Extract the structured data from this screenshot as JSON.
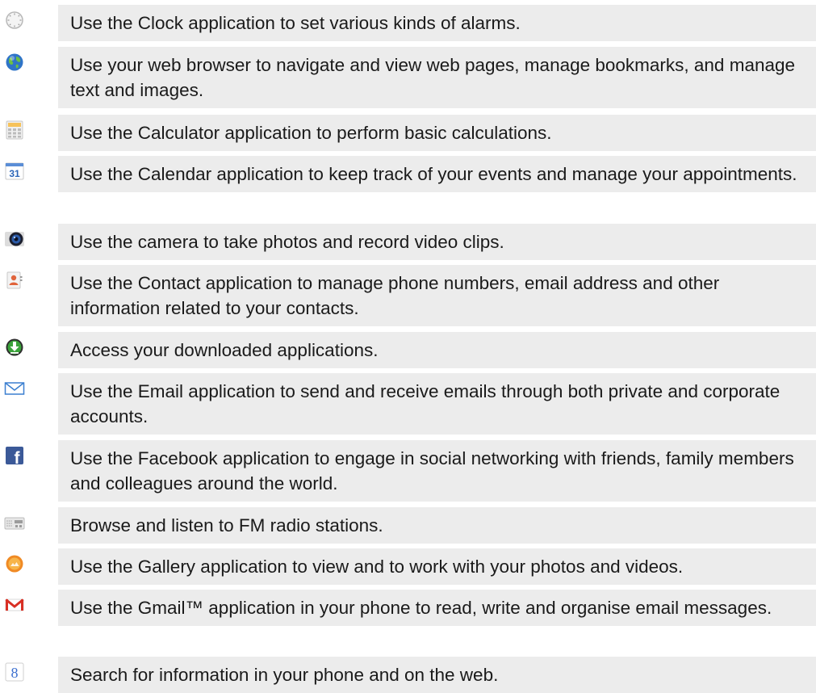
{
  "items": [
    {
      "icon": "clock-icon",
      "text": "Use the Clock application to set various kinds of alarms."
    },
    {
      "icon": "browser-globe-icon",
      "text": "Use your web browser to navigate and view web pages, manage bookmarks, and manage text and images."
    },
    {
      "icon": "calculator-icon",
      "text": "Use the Calculator application to perform basic calculations."
    },
    {
      "icon": "calendar-icon",
      "text": "Use the Calendar application to keep track of your events and manage your appointments.",
      "icon_label": "31"
    },
    {
      "icon": "camera-icon",
      "text": "Use the camera to take photos and record video clips."
    },
    {
      "icon": "contacts-icon",
      "text": "Use the Contact application to manage phone numbers, email address and other information related to your contacts."
    },
    {
      "icon": "download-icon",
      "text": "Access your downloaded applications."
    },
    {
      "icon": "email-envelope-icon",
      "text": "Use the Email application to send and receive emails through both private and corporate accounts."
    },
    {
      "icon": "facebook-icon",
      "text": "Use the Facebook application to engage in social networking with friends, family members and colleagues around the world.",
      "icon_label": "f"
    },
    {
      "icon": "fm-radio-icon",
      "text": "Browse and listen to FM radio stations."
    },
    {
      "icon": "gallery-icon",
      "text": "Use the Gallery application to view and to work with your photos and videos."
    },
    {
      "icon": "gmail-icon",
      "text": "Use the Gmail™ application in your phone to read, write and organise email messages."
    },
    {
      "icon": "google-search-icon",
      "text": "Search for information in your phone and on the web.",
      "icon_label": "8"
    }
  ],
  "colors": {
    "row_background": "#ececec",
    "text": "#1a1a1a"
  }
}
